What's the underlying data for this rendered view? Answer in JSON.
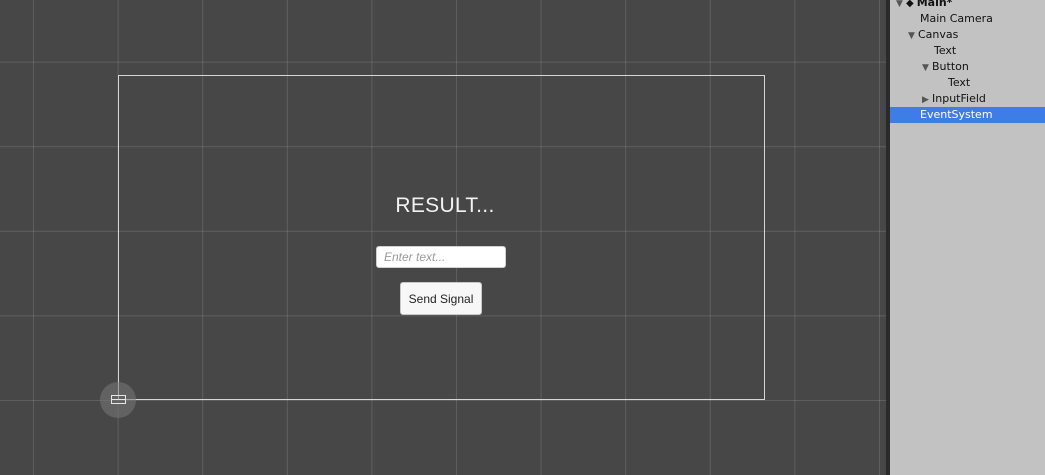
{
  "scene_view": {
    "result_text": "RESULT...",
    "input_placeholder": "Enter text...",
    "button_label": "Send Signal"
  },
  "hierarchy": {
    "scene_name": "Main*",
    "items": [
      {
        "label": "Main Camera",
        "expandable": false,
        "selected": false
      },
      {
        "label": "Canvas",
        "expandable": true,
        "expanded": true,
        "selected": false
      },
      {
        "label": "Text",
        "expandable": false,
        "selected": false
      },
      {
        "label": "Button",
        "expandable": true,
        "expanded": true,
        "selected": false
      },
      {
        "label": "Text",
        "expandable": false,
        "selected": false
      },
      {
        "label": "InputField",
        "expandable": true,
        "expanded": false,
        "selected": false
      },
      {
        "label": "EventSystem",
        "expandable": false,
        "selected": true
      }
    ],
    "arrows": {
      "expanded": "▼",
      "collapsed": "▶"
    },
    "colors": {
      "selection": "#3e7de5",
      "panel_bg": "#c2c2c2"
    }
  },
  "colors": {
    "scene_bg": "#474747",
    "grid_line": "#5c5c5c"
  }
}
